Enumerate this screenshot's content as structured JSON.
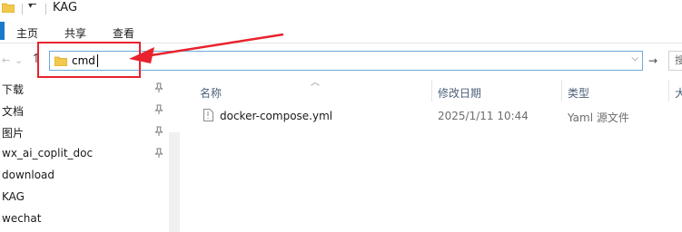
{
  "window": {
    "title": "KAG",
    "qat_icon": "dropdown-arrow-icon"
  },
  "ribbon": {
    "tabs": [
      {
        "label": "主页"
      },
      {
        "label": "共享"
      },
      {
        "label": "查看"
      }
    ]
  },
  "address": {
    "value": "cmd",
    "icon": "folder-icon"
  },
  "search": {
    "placeholder": "搜"
  },
  "nav_pane": {
    "items": [
      {
        "label": "下载",
        "pinned": true
      },
      {
        "label": "文档",
        "pinned": true
      },
      {
        "label": "图片",
        "pinned": true
      },
      {
        "label": "wx_ai_coplit_doc",
        "pinned": true
      },
      {
        "label": "download",
        "pinned": false
      },
      {
        "label": "KAG",
        "pinned": false
      },
      {
        "label": "wechat",
        "pinned": false
      }
    ]
  },
  "file_list": {
    "columns": [
      {
        "label": "名称"
      },
      {
        "label": "修改日期"
      },
      {
        "label": "类型"
      },
      {
        "label": "大"
      }
    ],
    "rows": [
      {
        "name": "docker-compose.yml",
        "modified": "2025/1/11 10:44",
        "type": "Yaml 源文件"
      }
    ]
  },
  "annotation": {
    "color": "#e8232d"
  }
}
